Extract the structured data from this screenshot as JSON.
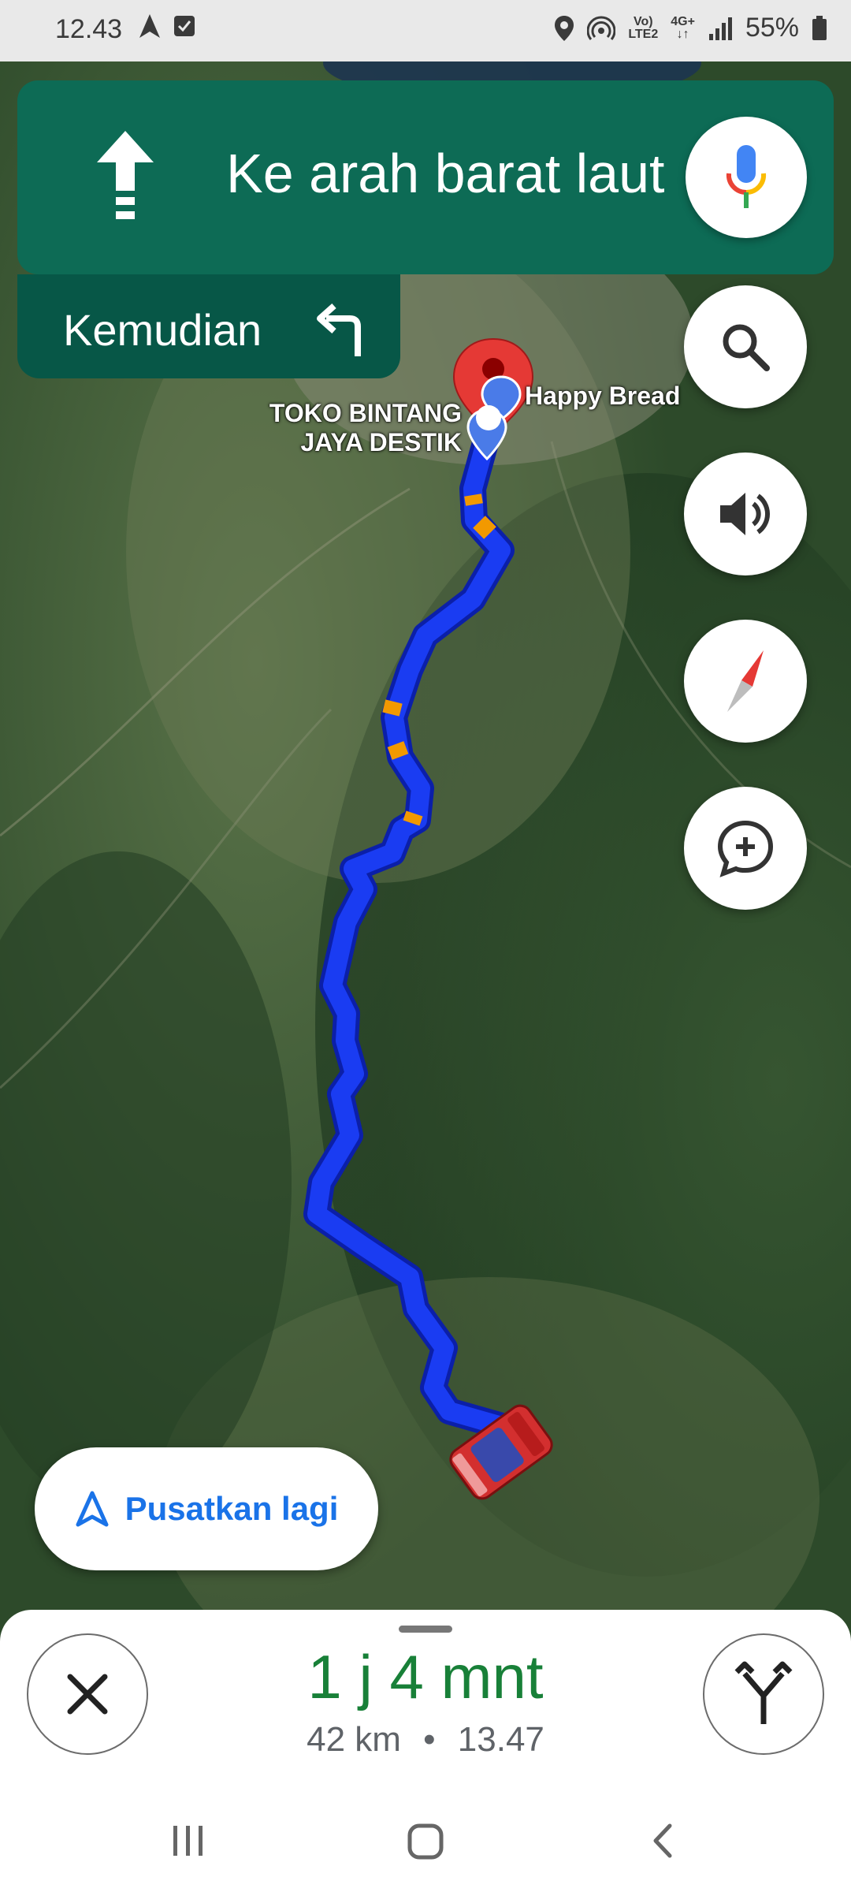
{
  "status_bar": {
    "time": "12.43",
    "battery": "55%",
    "network_top": "Vo)",
    "network_bottom": "LTE2",
    "data_type": "4G+"
  },
  "navigation": {
    "instruction": "Ke arah barat laut",
    "then_label": "Kemudian",
    "recenter_label": "Pusatkan lagi"
  },
  "map": {
    "places": [
      {
        "name": "Happy Bread"
      },
      {
        "name_line1": "TOKO BINTANG",
        "name_line2": "JAYA DESTIK"
      }
    ],
    "route_color": "#1a3cf2",
    "traffic_color": "#f29900"
  },
  "trip": {
    "eta": "1 j 4 mnt",
    "distance": "42 km",
    "separator": "•",
    "arrival": "13.47"
  },
  "icons": {
    "direction": "arrow-up-icon",
    "then": "turn-left-icon",
    "mic": "mic-icon",
    "search": "search-icon",
    "volume": "volume-icon",
    "compass": "compass-icon",
    "report": "add-report-icon",
    "recenter": "navigation-arrow-icon",
    "close": "close-icon",
    "routes": "alt-routes-icon"
  },
  "colors": {
    "nav_green": "#0d6b55",
    "eta_green": "#188038",
    "link_blue": "#1a73e8"
  }
}
